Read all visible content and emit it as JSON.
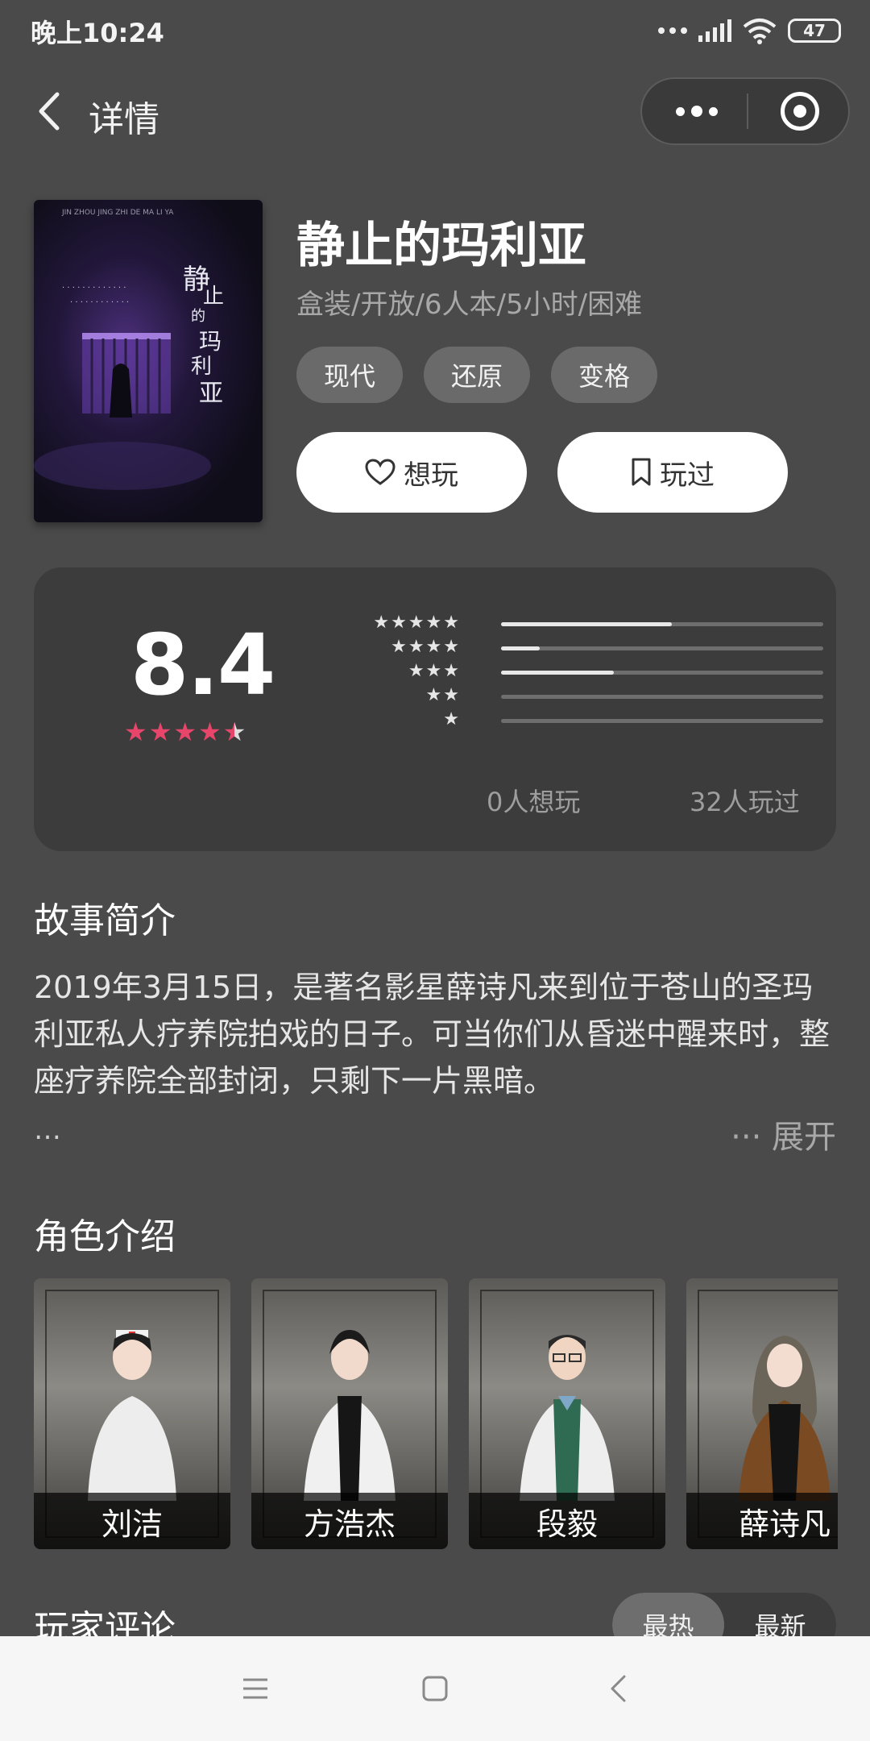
{
  "status_bar": {
    "time": "晚上10:24",
    "battery": "47"
  },
  "nav": {
    "title": "详情"
  },
  "game": {
    "title": "静止的玛利亚",
    "meta": "盒装/开放/6人本/5小时/困难",
    "tags": [
      "现代",
      "还原",
      "变格"
    ],
    "want_button": "想玩",
    "played_button": "玩过",
    "cover_title": "静止的玛利亚"
  },
  "rating": {
    "score": "8.4",
    "stars_value": 4.5,
    "distribution": [
      {
        "stars": "★★★★★",
        "fraction": 0.53
      },
      {
        "stars": "★★★★",
        "fraction": 0.12
      },
      {
        "stars": "★★★",
        "fraction": 0.35
      },
      {
        "stars": "★★",
        "fraction": 0.0
      },
      {
        "stars": "★",
        "fraction": 0.0
      }
    ],
    "want_count": "0人想玩",
    "played_count": "32人玩过"
  },
  "story": {
    "title": "故事简介",
    "text": "2019年3月15日，是著名影星薛诗凡来到位于苍山的圣玛利亚私人疗养院拍戏的日子。可当你们从昏迷中醒来时，整座疗养院全部封闭，只剩下一片黑暗。",
    "ellipsis": "…",
    "expand": "··· 展开"
  },
  "roles": {
    "title": "角色介绍",
    "items": [
      {
        "name": "刘洁"
      },
      {
        "name": "方浩杰"
      },
      {
        "name": "段毅"
      },
      {
        "name": "薛诗凡"
      }
    ]
  },
  "comments": {
    "title": "玩家评论",
    "sort_hot": "最热",
    "sort_new": "最新"
  },
  "colors": {
    "accent_star": "#e8456b",
    "background": "#4a4a4a",
    "card": "#3c3c3c"
  }
}
